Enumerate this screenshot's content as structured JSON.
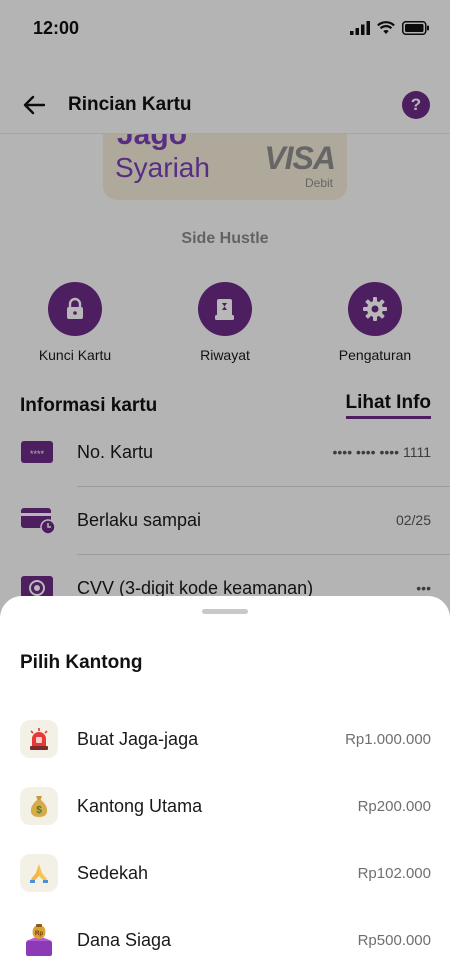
{
  "status": {
    "time": "12:00"
  },
  "header": {
    "title": "Rincian Kartu",
    "help_label": "?"
  },
  "card": {
    "brand_top": "Jago",
    "brand": "Syariah",
    "network": "VISA",
    "type": "Debit",
    "name": "Side Hustle"
  },
  "actions": [
    {
      "label": "Kunci Kartu",
      "icon": "lock-icon"
    },
    {
      "label": "Riwayat",
      "icon": "history-icon"
    },
    {
      "label": "Pengaturan",
      "icon": "gear-icon"
    }
  ],
  "info": {
    "title": "Informasi kartu",
    "link": "Lihat Info",
    "rows": [
      {
        "label": "No. Kartu",
        "value": "•••• •••• •••• 1111",
        "icon": "card-number-icon"
      },
      {
        "label": "Berlaku sampai",
        "value": "02/25",
        "icon": "card-expiry-icon"
      },
      {
        "label": "CVV (3-digit kode keamanan)",
        "value": "•••",
        "icon": "cvv-icon"
      }
    ]
  },
  "sheet": {
    "title": "Pilih Kantong",
    "pockets": [
      {
        "name": "Buat Jaga-jaga",
        "amount": "Rp1.000.000",
        "icon": "siren-icon"
      },
      {
        "name": "Kantong Utama",
        "amount": "Rp200.000",
        "icon": "money-bag-icon"
      },
      {
        "name": "Sedekah",
        "amount": "Rp102.000",
        "icon": "praying-hands-icon"
      },
      {
        "name": "Dana Siaga",
        "amount": "Rp500.000",
        "icon": "treasure-box-icon"
      }
    ]
  },
  "colors": {
    "primary": "#6b2a86",
    "card_bg": "#f2ebd6",
    "brand_text": "#7a3fb8"
  }
}
